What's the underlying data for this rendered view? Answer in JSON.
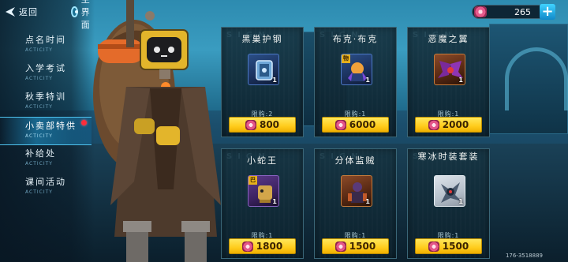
{
  "top_bar": {
    "back_label": "返回",
    "home_label": "主界面"
  },
  "currency": {
    "value": "265",
    "plus": "+"
  },
  "menu": {
    "items": [
      {
        "name": "点名时间",
        "sub": "ACTICITY"
      },
      {
        "name": "入学考试",
        "sub": "ACTICITY"
      },
      {
        "name": "秋季特训",
        "sub": "ACTICITY"
      },
      {
        "name": "小卖部特供",
        "sub": "ACTICITY",
        "active": true,
        "badge": true
      },
      {
        "name": "补给处",
        "sub": "ACTICITY"
      },
      {
        "name": "课间活动",
        "sub": "ACTICITY"
      }
    ]
  },
  "cards": [
    {
      "title": "黑巢护钢",
      "limit": "限购:2",
      "price": "800",
      "count": "1",
      "frame": "blue",
      "watermark": "SIGN"
    },
    {
      "title": "布克·布克",
      "limit": "限购:1",
      "price": "6000",
      "count": "1",
      "frame": "blue",
      "tag": "物",
      "watermark": "SIGN"
    },
    {
      "title": "恶魔之翼",
      "limit": "限购:1",
      "price": "2000",
      "count": "1",
      "frame": "orange",
      "watermark": "SIGN"
    },
    {
      "title": "小蛇王",
      "limit": "限购:1",
      "price": "1800",
      "count": "1",
      "frame": "orange",
      "tag": "巴",
      "watermark": "SIGN"
    },
    {
      "title": "分体监贼",
      "limit": "限购:1",
      "price": "1500",
      "count": "1",
      "frame": "orange",
      "watermark": "SIGN"
    },
    {
      "title": "寒冰时装套装",
      "limit": "限购:1",
      "price": "1500",
      "count": "1",
      "frame": "white",
      "watermark": "SIGN"
    }
  ],
  "uid": "176-3518889",
  "colors": {
    "accent": "#1fb4ea",
    "price_button": "#ffd21f",
    "badge": "#ff2d3b",
    "panel": "#16344a"
  },
  "icons": {
    "back": "back-arrow-icon",
    "home": "home-icon",
    "currency": "gem-currency-icon",
    "plus": "plus-icon"
  }
}
